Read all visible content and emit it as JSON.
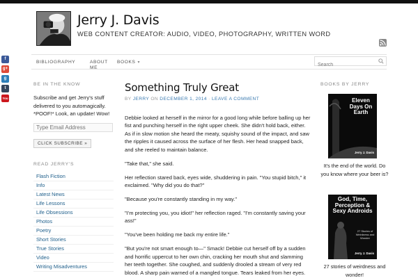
{
  "site": {
    "title": "Jerry J. Davis",
    "description": "WEB CONTENT CREATOR: AUDIO, VIDEO, PHOTOGRAPHY, WRITTEN WORD"
  },
  "nav": {
    "items": [
      {
        "label": "BIBLIOGRAPHY"
      },
      {
        "label": "ABOUT ME"
      },
      {
        "label": "BOOKS",
        "has_dropdown": true
      }
    ],
    "search_placeholder": "Search"
  },
  "social": [
    {
      "icon": "facebook-icon",
      "color": "#3b5998",
      "glyph": "f"
    },
    {
      "icon": "google-plus-icon",
      "color": "#dd4b39",
      "glyph": "g+"
    },
    {
      "icon": "goodreads-icon",
      "color": "#2e7fb8",
      "glyph": "g"
    },
    {
      "icon": "tumblr-icon",
      "color": "#35465c",
      "glyph": "t"
    },
    {
      "icon": "youtube-icon",
      "color": "#cc181e",
      "glyph": "You"
    }
  ],
  "sidebar_left": {
    "subscribe_title": "BE IN THE KNOW",
    "subscribe_text": "Subscribe and get Jerry's stuff delivered to you automagically. *POOF!* Look, an update! Wow!",
    "email_placeholder": "Type Email Address",
    "subscribe_button": "CLICK SUBSCRIBE »",
    "categories_title": "READ JERRY'S",
    "categories": [
      "Flash Fiction",
      "Info",
      "Latest News",
      "Life Lessons",
      "Life Obsessions",
      "Photos",
      "Poetry",
      "Short Stories",
      "True Stories",
      "Video",
      "Writing Misadventures"
    ]
  },
  "post": {
    "title": "Something Truly Great",
    "meta_by": "BY",
    "meta_author": "JERRY",
    "meta_on": "ON",
    "meta_date": "DECEMBER 1, 2014",
    "meta_sep": "·",
    "meta_comment": "LEAVE A COMMENT",
    "paragraphs": [
      "Debbie looked at herself in the mirror for a good long while before balling up her fist and punching herself in the right upper cheek. She didn't hold back, either. As if in slow motion she heard the meaty, squishy sound of the impact, and saw the ripples it caused across the surface of her flesh. Her head snapped back, and she reeled to maintain balance.",
      "\"Take that,\" she said.",
      "Her reflection stared back, eyes wide, shuddering in pain. \"You stupid bitch,\" it exclaimed. \"Why did you do that?\"",
      "\"Because you're constantly standing in my way.\"",
      "\"I'm protecting you, you idiot!\" her reflection raged. \"I'm constantly saving your ass!\"",
      "\"You've been holding me back my entire life.\"",
      "\"But you're not smart enough to—\" Smack! Debbie cut herself off by a sudden and horrific uppercut to her own chin, cracking her mouth shut and slamming her teeth together. She coughed, and suddenly drooled a stream of very red blood. A sharp pain warned of a mangled tongue. Tears leaked from her eyes."
    ]
  },
  "sidebar_right": {
    "books_title": "BOOKS BY JERRY",
    "book1": {
      "title": "Eleven Days On Earth",
      "author": "Jerry J. Davis",
      "caption": "It's the end of the world. Do you know where your beer is?"
    },
    "book2": {
      "title": "God, Time, Perception & Sexy Androids",
      "subtitle": "27 Stories of Weirdness and Wonder",
      "author": "Jerry J. Davis",
      "caption": "27 stories of weirdness and wonder!"
    }
  }
}
